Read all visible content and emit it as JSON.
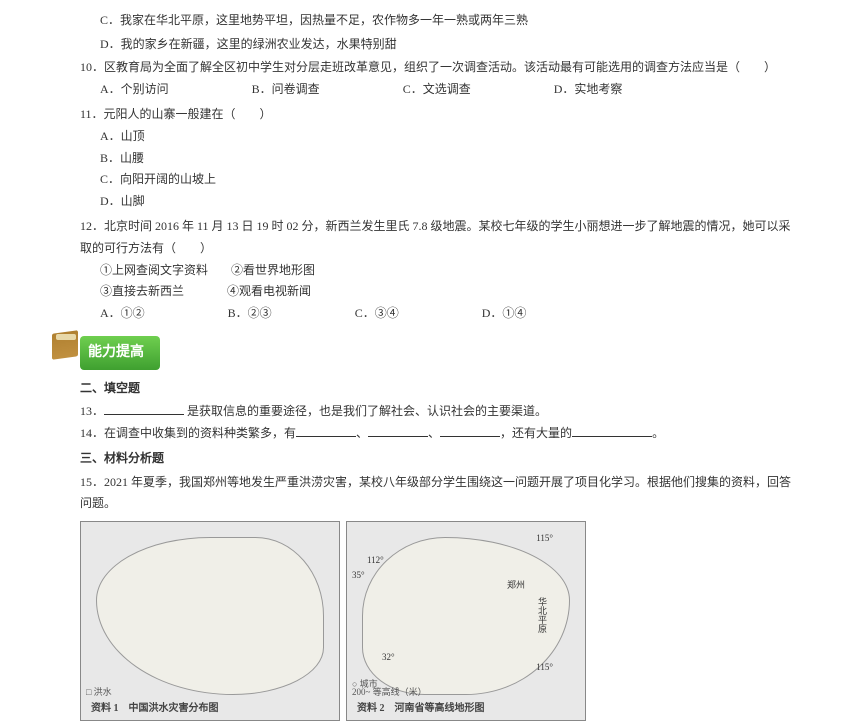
{
  "q_fragment": {
    "opt_c": "C．我家在华北平原，这里地势平坦，因热量不足，农作物多一年一熟或两年三熟",
    "opt_d": "D．我的家乡在新疆，这里的绿洲农业发达，水果特别甜"
  },
  "q10": {
    "text": "10．区教育局为全面了解全区初中学生对分层走班改革意见，组织了一次调查活动。该活动最有可能选用的调查方法应当是（　　）",
    "a": "A．个别访问",
    "b": "B．问卷调查",
    "c": "C．文选调查",
    "d": "D．实地考察"
  },
  "q11": {
    "text": "11．元阳人的山寨一般建在（　　）",
    "a": "A．山顶",
    "b": "B．山腰",
    "c": "C．向阳开阔的山坡上",
    "d": "D．山脚"
  },
  "q12": {
    "text": "12．北京时间 2016 年 11 月 13 日 19 时 02 分，新西兰发生里氏 7.8 级地震。某校七年级的学生小丽想进一步了解地震的情况，她可以采取的可行方法有（　　）",
    "c1": "①上网查阅文字资料",
    "c2": "②看世界地形图",
    "c3": "③直接去新西兰",
    "c4": "④观看电视新闻",
    "a": "A．①②",
    "b": "B．②③",
    "c": "C．③④",
    "d": "D．①④"
  },
  "badge": "能力提高",
  "section2": "二、填空题",
  "q13": {
    "num": "13．",
    "tail": "是获取信息的重要途径，也是我们了解社会、认识社会的主要渠道。"
  },
  "q14": {
    "pre": "14．在调查中收集到的资料种类繁多，有",
    "sep": "、",
    "mid": "，还有大量的",
    "end": "。"
  },
  "section3": "三、材料分析题",
  "q15": {
    "text": "15．2021 年夏季，我国郑州等地发生严重洪涝灾害，某校八年级部分学生围绕这一问题开展了项目化学习。根据他们搜集的资料，回答问题。"
  },
  "fig1": {
    "caption": "资料 1　中国洪水灾害分布图",
    "legend": "□ 洪水"
  },
  "fig2": {
    "caption": "资料 2　河南省等高线地形图",
    "legend_city": "○ 城市",
    "legend_contour": "200~ 等高线（米）",
    "label_zz": "郑州",
    "label_hbph": "华北平原",
    "coord_115": "115°",
    "coord_112": "112°",
    "coord_35": "35°",
    "coord_32": "32°"
  }
}
